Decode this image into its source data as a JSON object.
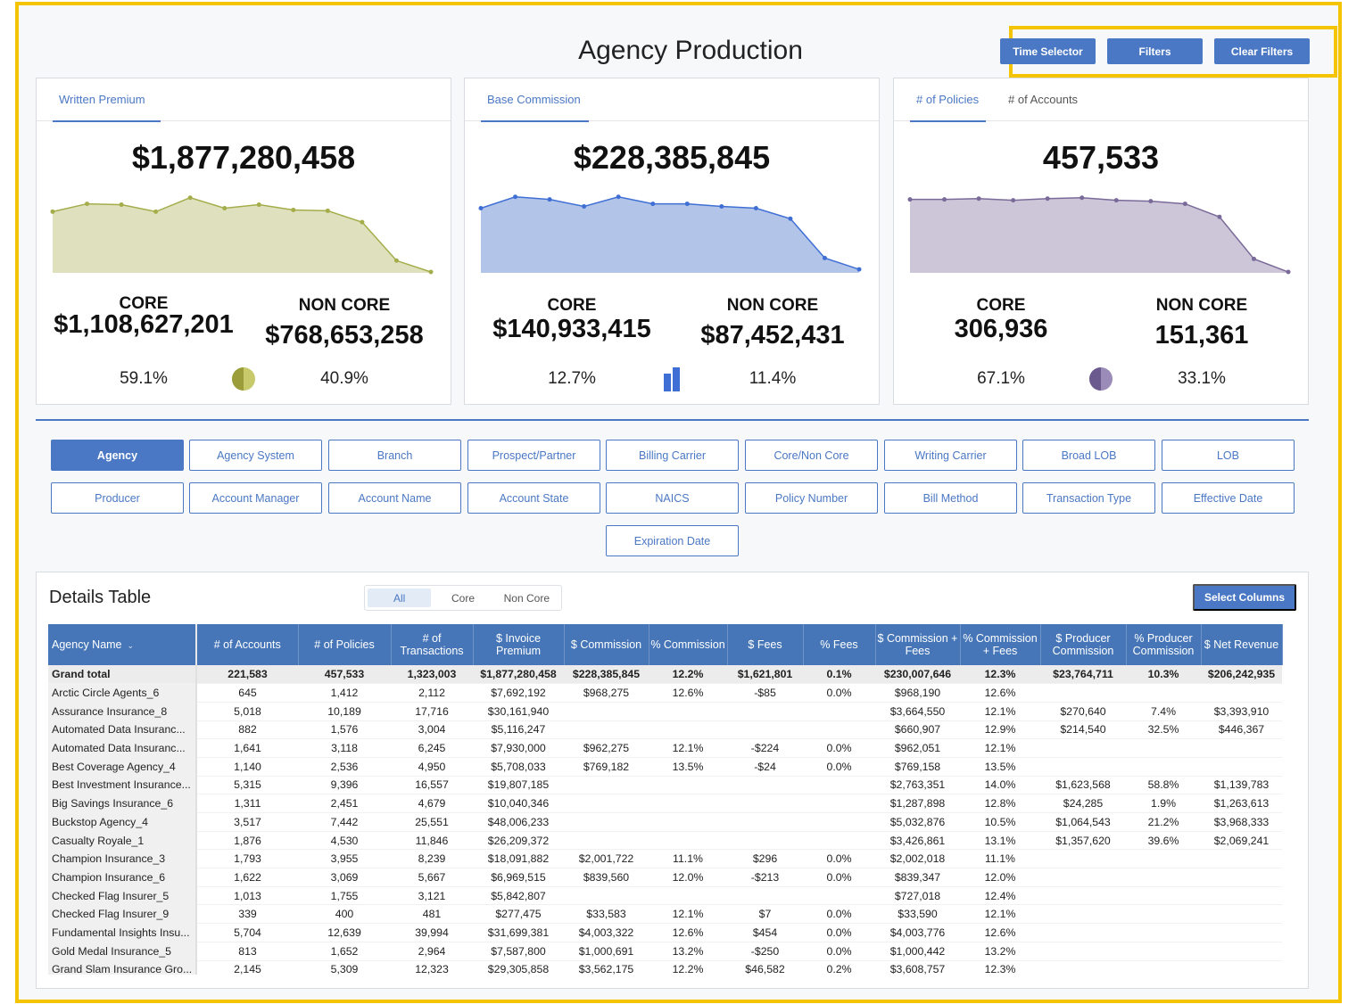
{
  "header": {
    "title": "Agency Production",
    "buttons": [
      "Time Selector",
      "Filters",
      "Clear Filters"
    ]
  },
  "colors": {
    "accent": "#4a78c4",
    "highlight": "#f5c400",
    "premium": "#a4ad4a",
    "commission": "#3f6fd4",
    "policies": "#7a6a9a"
  },
  "cards": [
    {
      "tabs": [
        "Written Premium"
      ],
      "active_tab": 0,
      "total": "$1,877,280,458",
      "core_label": "CORE",
      "noncore_label": "NON CORE",
      "core": "$1,108,627,201",
      "noncore": "$768,653,258",
      "core_pct": "59.1%",
      "noncore_pct": "40.9%",
      "icon": "pie-chart-icon",
      "trend": [
        70,
        79,
        78,
        70,
        86,
        74,
        78,
        72,
        71,
        58,
        14,
        1
      ]
    },
    {
      "tabs": [
        "Base Commission"
      ],
      "active_tab": 0,
      "total": "$228,385,845",
      "core_label": "CORE",
      "noncore_label": "NON CORE",
      "core": "$140,933,415",
      "noncore": "$87,452,431",
      "core_pct": "12.7%",
      "noncore_pct": "11.4%",
      "icon": "bar-chart-icon",
      "trend": [
        74,
        87,
        84,
        76,
        87,
        79,
        79,
        76,
        74,
        62,
        17,
        4
      ]
    },
    {
      "tabs": [
        "# of Policies",
        "# of Accounts"
      ],
      "active_tab": 0,
      "total": "457,533",
      "core_label": "CORE",
      "noncore_label": "NON CORE",
      "core": "306,936",
      "noncore": "151,361",
      "core_pct": "67.1%",
      "noncore_pct": "33.1%",
      "icon": "pie-chart-icon",
      "trend": [
        84,
        84,
        85,
        83,
        85,
        86,
        83,
        82,
        79,
        64,
        16,
        1
      ]
    }
  ],
  "dimensions": {
    "active": "Agency",
    "items": [
      "Agency",
      "Agency System",
      "Branch",
      "Prospect/Partner",
      "Billing Carrier",
      "Core/Non Core",
      "Writing Carrier",
      "Broad LOB",
      "LOB",
      "Producer",
      "Account Manager",
      "Account Name",
      "Account State",
      "NAICS",
      "Policy Number",
      "Bill Method",
      "Transaction Type",
      "Effective Date",
      "Expiration Date"
    ]
  },
  "details": {
    "title": "Details Table",
    "segments": [
      "All",
      "Core",
      "Non Core"
    ],
    "active_segment": "All",
    "select_columns": "Select Columns",
    "columns": [
      "Agency Name",
      "# of Accounts",
      "# of Policies",
      "# of Transactions",
      "$ Invoice Premium",
      "$ Commission",
      "% Commission",
      "$ Fees",
      "% Fees",
      "$ Commission + Fees",
      "% Commission + Fees",
      "$ Producer Commission",
      "% Producer Commission",
      "$ Net Revenue"
    ],
    "total": [
      "Grand total",
      "221,583",
      "457,533",
      "1,323,003",
      "$1,877,280,458",
      "$228,385,845",
      "12.2%",
      "$1,621,801",
      "0.1%",
      "$230,007,646",
      "12.3%",
      "$23,764,711",
      "10.3%",
      "$206,242,935"
    ],
    "rows": [
      [
        "Arctic Circle Agents_6",
        "645",
        "1,412",
        "2,112",
        "$7,692,192",
        "$968,275",
        "12.6%",
        "-$85",
        "0.0%",
        "$968,190",
        "12.6%",
        "",
        "",
        ""
      ],
      [
        "Assurance Insurance_8",
        "5,018",
        "10,189",
        "17,716",
        "$30,161,940",
        "",
        "",
        "",
        "",
        "$3,664,550",
        "12.1%",
        "$270,640",
        "7.4%",
        "$3,393,910"
      ],
      [
        "Automated Data Insuranc...",
        "882",
        "1,576",
        "3,004",
        "$5,116,247",
        "",
        "",
        "",
        "",
        "$660,907",
        "12.9%",
        "$214,540",
        "32.5%",
        "$446,367"
      ],
      [
        "Automated Data Insuranc...",
        "1,641",
        "3,118",
        "6,245",
        "$7,930,000",
        "$962,275",
        "12.1%",
        "-$224",
        "0.0%",
        "$962,051",
        "12.1%",
        "",
        "",
        ""
      ],
      [
        "Best Coverage Agency_4",
        "1,140",
        "2,536",
        "4,950",
        "$5,708,033",
        "$769,182",
        "13.5%",
        "-$24",
        "0.0%",
        "$769,158",
        "13.5%",
        "",
        "",
        ""
      ],
      [
        "Best Investment Insurance...",
        "5,315",
        "9,396",
        "16,557",
        "$19,807,185",
        "",
        "",
        "",
        "",
        "$2,763,351",
        "14.0%",
        "$1,623,568",
        "58.8%",
        "$1,139,783"
      ],
      [
        "Big Savings Insurance_6",
        "1,311",
        "2,451",
        "4,679",
        "$10,040,346",
        "",
        "",
        "",
        "",
        "$1,287,898",
        "12.8%",
        "$24,285",
        "1.9%",
        "$1,263,613"
      ],
      [
        "Buckstop Agency_4",
        "3,517",
        "7,442",
        "25,551",
        "$48,006,233",
        "",
        "",
        "",
        "",
        "$5,032,876",
        "10.5%",
        "$1,064,543",
        "21.2%",
        "$3,968,333"
      ],
      [
        "Casualty Royale_1",
        "1,876",
        "4,530",
        "11,846",
        "$26,209,372",
        "",
        "",
        "",
        "",
        "$3,426,861",
        "13.1%",
        "$1,357,620",
        "39.6%",
        "$2,069,241"
      ],
      [
        "Champion Insurance_3",
        "1,793",
        "3,955",
        "8,239",
        "$18,091,882",
        "$2,001,722",
        "11.1%",
        "$296",
        "0.0%",
        "$2,002,018",
        "11.1%",
        "",
        "",
        ""
      ],
      [
        "Champion Insurance_6",
        "1,622",
        "3,069",
        "5,667",
        "$6,969,515",
        "$839,560",
        "12.0%",
        "-$213",
        "0.0%",
        "$839,347",
        "12.0%",
        "",
        "",
        ""
      ],
      [
        "Checked Flag Insurer_5",
        "1,013",
        "1,755",
        "3,121",
        "$5,842,807",
        "",
        "",
        "",
        "",
        "$727,018",
        "12.4%",
        "",
        "",
        ""
      ],
      [
        "Checked Flag Insurer_9",
        "339",
        "400",
        "481",
        "$277,475",
        "$33,583",
        "12.1%",
        "$7",
        "0.0%",
        "$33,590",
        "12.1%",
        "",
        "",
        ""
      ],
      [
        "Fundamental Insights Insu...",
        "5,704",
        "12,639",
        "39,994",
        "$31,699,381",
        "$4,003,322",
        "12.6%",
        "$454",
        "0.0%",
        "$4,003,776",
        "12.6%",
        "",
        "",
        ""
      ],
      [
        "Gold Medal Insurance_5",
        "813",
        "1,652",
        "2,964",
        "$7,587,800",
        "$1,000,691",
        "13.2%",
        "-$250",
        "0.0%",
        "$1,000,442",
        "13.2%",
        "",
        "",
        ""
      ],
      [
        "Grand Slam Insurance Gro...",
        "2,145",
        "5,309",
        "12,323",
        "$29,305,858",
        "$3,562,175",
        "12.2%",
        "$46,582",
        "0.2%",
        "$3,608,757",
        "12.3%",
        "",
        "",
        ""
      ]
    ]
  }
}
